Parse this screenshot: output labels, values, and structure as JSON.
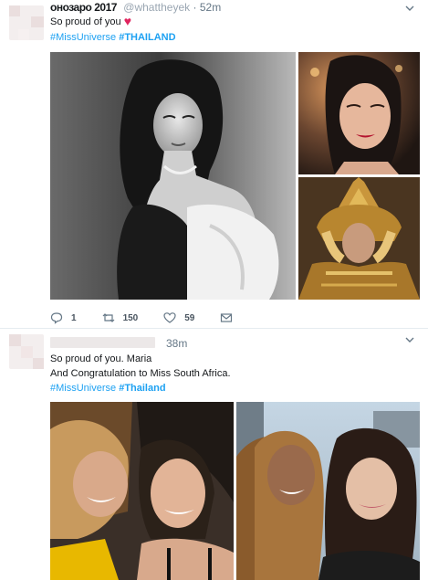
{
  "tweets": [
    {
      "header": {
        "name": "онозаро 2017",
        "handle": "@whattheyek",
        "time": "52m"
      },
      "text_line1": "So proud of you",
      "hashtags": {
        "first": "#MissUniverse",
        "second": "#THAILAND"
      },
      "actions": {
        "reply_count": "1",
        "retweet_count": "150",
        "like_count": "59"
      },
      "photos": [
        "black-and-white portrait",
        "red-lipstick portrait",
        "golden headdress portrait"
      ]
    },
    {
      "header": {
        "time": "38m"
      },
      "text_line1": "So proud of you. Maria",
      "text_line2": "And Congratulation to Miss South Africa.",
      "hashtags": {
        "first": "#MissUniverse",
        "second": "#Thailand"
      },
      "photos": [
        "two women lying together selfie",
        "two women outdoor selfie"
      ]
    }
  ],
  "colors": {
    "link": "#1da1f2",
    "heart": "#e0245e",
    "muted": "#657786"
  }
}
